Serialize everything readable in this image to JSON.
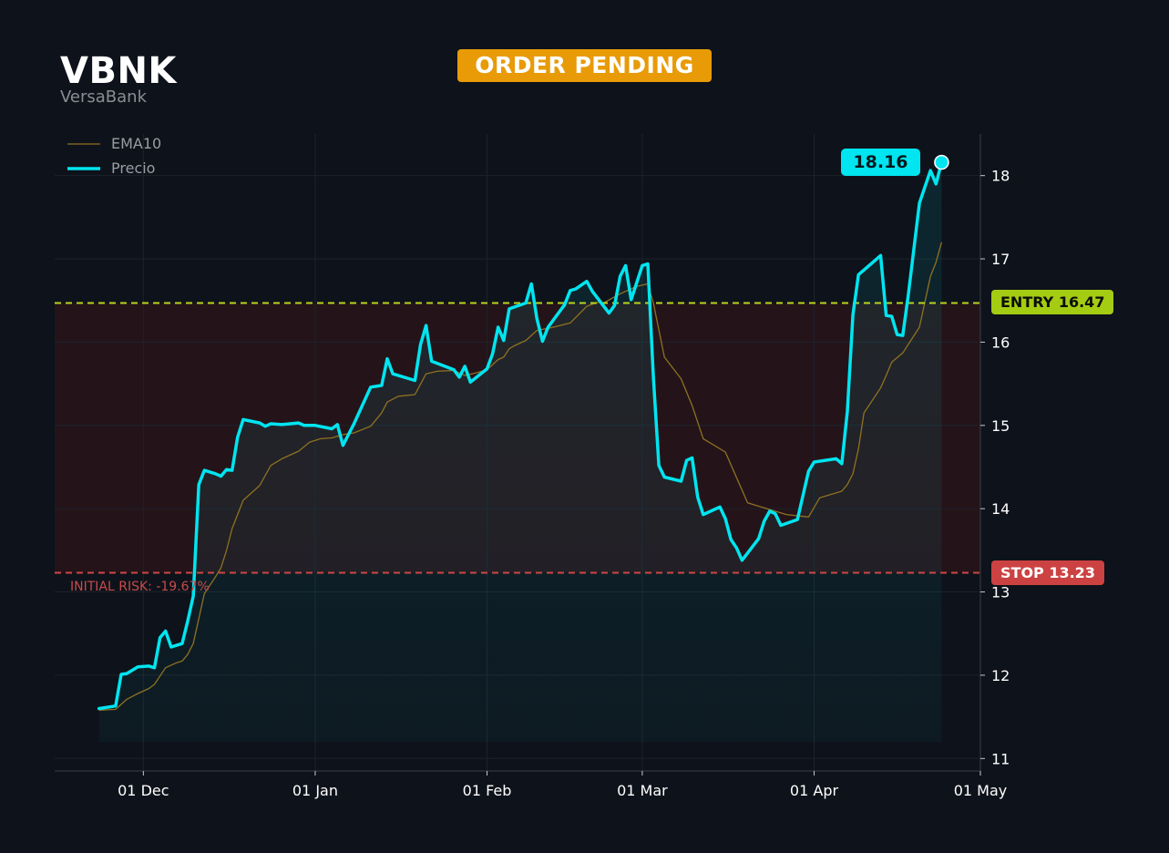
{
  "header": {
    "ticker": "VBNK",
    "company": "VersaBank",
    "status": "ORDER PENDING"
  },
  "colors": {
    "background": "#0e121a",
    "price_line": "#00e5f0",
    "ema_line": "#8f7121",
    "entry_line": "#b8d41c",
    "entry_tag": "#a4cc12",
    "stop_line": "#cf4646",
    "stop_tag": "#cc4242",
    "badge": "#e89b07",
    "risk_zone": "#2a1519"
  },
  "levels": {
    "entry": {
      "label": "ENTRY 16.47",
      "value": 16.47
    },
    "stop": {
      "label": "STOP 13.23",
      "value": 13.23
    },
    "risk_label": "INITIAL RISK: -19.67%"
  },
  "last_price": {
    "label": "18.16",
    "value": 18.16
  },
  "chart_data": {
    "type": "line",
    "legend": {
      "placement": "top-left",
      "entries": [
        "EMA10",
        "Precio"
      ]
    },
    "grid": true,
    "x_axis": {
      "type": "date",
      "range": [
        "2024-11-15",
        "2025-05-01"
      ],
      "tick_labels": [
        "01 Dec",
        "01 Jan",
        "01 Feb",
        "01 Mar",
        "01 Apr",
        "01 May"
      ],
      "tick_dates": [
        "2024-12-01",
        "2025-01-01",
        "2025-02-01",
        "2025-03-01",
        "2025-04-01",
        "2025-05-01"
      ]
    },
    "y_axis": {
      "range": [
        10.85,
        18.5
      ],
      "ticks": [
        11,
        12,
        13,
        14,
        15,
        16,
        17,
        18
      ]
    },
    "series": [
      {
        "name": "EMA10",
        "points": [
          [
            "2024-11-23",
            11.58
          ],
          [
            "2024-11-26",
            11.59
          ],
          [
            "2024-11-28",
            11.71
          ],
          [
            "2024-11-30",
            11.78
          ],
          [
            "2024-12-02",
            11.84
          ],
          [
            "2024-12-03",
            11.89
          ],
          [
            "2024-12-05",
            12.09
          ],
          [
            "2024-12-07",
            12.15
          ],
          [
            "2024-12-08",
            12.17
          ],
          [
            "2024-12-09",
            12.25
          ],
          [
            "2024-12-10",
            12.38
          ],
          [
            "2024-12-12",
            12.98
          ],
          [
            "2024-12-14",
            13.18
          ],
          [
            "2024-12-15",
            13.29
          ],
          [
            "2024-12-16",
            13.5
          ],
          [
            "2024-12-17",
            13.76
          ],
          [
            "2024-12-19",
            14.1
          ],
          [
            "2024-12-22",
            14.28
          ],
          [
            "2024-12-24",
            14.52
          ],
          [
            "2024-12-26",
            14.6
          ],
          [
            "2024-12-29",
            14.69
          ],
          [
            "2024-12-31",
            14.8
          ],
          [
            "2025-01-02",
            14.84
          ],
          [
            "2025-01-04",
            14.85
          ],
          [
            "2025-01-06",
            14.89
          ],
          [
            "2025-01-08",
            14.91
          ],
          [
            "2025-01-11",
            14.99
          ],
          [
            "2025-01-13",
            15.15
          ],
          [
            "2025-01-14",
            15.28
          ],
          [
            "2025-01-16",
            15.35
          ],
          [
            "2025-01-19",
            15.37
          ],
          [
            "2025-01-21",
            15.62
          ],
          [
            "2025-01-23",
            15.65
          ],
          [
            "2025-01-26",
            15.66
          ],
          [
            "2025-01-28",
            15.6
          ],
          [
            "2025-01-30",
            15.63
          ],
          [
            "2025-02-01",
            15.67
          ],
          [
            "2025-02-03",
            15.79
          ],
          [
            "2025-02-04",
            15.82
          ],
          [
            "2025-02-05",
            15.92
          ],
          [
            "2025-02-06",
            15.96
          ],
          [
            "2025-02-08",
            16.02
          ],
          [
            "2025-02-10",
            16.14
          ],
          [
            "2025-02-13",
            16.18
          ],
          [
            "2025-02-16",
            16.23
          ],
          [
            "2025-02-19",
            16.43
          ],
          [
            "2025-02-21",
            16.48
          ],
          [
            "2025-02-22",
            16.47
          ],
          [
            "2025-02-25",
            16.58
          ],
          [
            "2025-02-28",
            16.67
          ],
          [
            "2025-03-02",
            16.7
          ],
          [
            "2025-03-03",
            16.47
          ],
          [
            "2025-03-05",
            15.82
          ],
          [
            "2025-03-08",
            15.56
          ],
          [
            "2025-03-10",
            15.24
          ],
          [
            "2025-03-12",
            14.84
          ],
          [
            "2025-03-16",
            14.68
          ],
          [
            "2025-03-20",
            14.07
          ],
          [
            "2025-03-24",
            13.99
          ],
          [
            "2025-03-27",
            13.93
          ],
          [
            "2025-03-31",
            13.9
          ],
          [
            "2025-04-02",
            14.13
          ],
          [
            "2025-04-06",
            14.21
          ],
          [
            "2025-04-07",
            14.29
          ],
          [
            "2025-04-08",
            14.42
          ],
          [
            "2025-04-09",
            14.72
          ],
          [
            "2025-04-10",
            15.15
          ],
          [
            "2025-04-13",
            15.45
          ],
          [
            "2025-04-14",
            15.6
          ],
          [
            "2025-04-15",
            15.76
          ],
          [
            "2025-04-17",
            15.87
          ],
          [
            "2025-04-20",
            16.18
          ],
          [
            "2025-04-22",
            16.79
          ],
          [
            "2025-04-23",
            16.96
          ],
          [
            "2025-04-24",
            17.2
          ]
        ]
      },
      {
        "name": "Precio",
        "points": [
          [
            "2024-11-23",
            11.6
          ],
          [
            "2024-11-26",
            11.63
          ],
          [
            "2024-11-27",
            12.01
          ],
          [
            "2024-11-28",
            12.02
          ],
          [
            "2024-11-30",
            12.1
          ],
          [
            "2024-12-02",
            12.11
          ],
          [
            "2024-12-03",
            12.09
          ],
          [
            "2024-12-04",
            12.45
          ],
          [
            "2024-12-05",
            12.53
          ],
          [
            "2024-12-06",
            12.34
          ],
          [
            "2024-12-08",
            12.38
          ],
          [
            "2024-12-09",
            12.65
          ],
          [
            "2024-12-10",
            12.95
          ],
          [
            "2024-12-11",
            14.29
          ],
          [
            "2024-12-12",
            14.46
          ],
          [
            "2024-12-14",
            14.42
          ],
          [
            "2024-12-15",
            14.39
          ],
          [
            "2024-12-16",
            14.47
          ],
          [
            "2024-12-17",
            14.46
          ],
          [
            "2024-12-18",
            14.86
          ],
          [
            "2024-12-19",
            15.07
          ],
          [
            "2024-12-22",
            15.03
          ],
          [
            "2024-12-23",
            14.99
          ],
          [
            "2024-12-24",
            15.02
          ],
          [
            "2024-12-26",
            15.01
          ],
          [
            "2024-12-29",
            15.03
          ],
          [
            "2024-12-30",
            15.0
          ],
          [
            "2025-01-01",
            15.0
          ],
          [
            "2025-01-04",
            14.96
          ],
          [
            "2025-01-05",
            15.01
          ],
          [
            "2025-01-06",
            14.76
          ],
          [
            "2025-01-08",
            15.02
          ],
          [
            "2025-01-11",
            15.46
          ],
          [
            "2025-01-12",
            15.47
          ],
          [
            "2025-01-13",
            15.48
          ],
          [
            "2025-01-14",
            15.8
          ],
          [
            "2025-01-15",
            15.62
          ],
          [
            "2025-01-19",
            15.54
          ],
          [
            "2025-01-20",
            15.97
          ],
          [
            "2025-01-21",
            16.2
          ],
          [
            "2025-01-22",
            15.77
          ],
          [
            "2025-01-26",
            15.67
          ],
          [
            "2025-01-27",
            15.58
          ],
          [
            "2025-01-28",
            15.71
          ],
          [
            "2025-01-29",
            15.52
          ],
          [
            "2025-02-01",
            15.68
          ],
          [
            "2025-02-02",
            15.86
          ],
          [
            "2025-02-03",
            16.18
          ],
          [
            "2025-02-04",
            16.02
          ],
          [
            "2025-02-05",
            16.4
          ],
          [
            "2025-02-08",
            16.47
          ],
          [
            "2025-02-09",
            16.7
          ],
          [
            "2025-02-10",
            16.28
          ],
          [
            "2025-02-11",
            16.01
          ],
          [
            "2025-02-12",
            16.18
          ],
          [
            "2025-02-15",
            16.45
          ],
          [
            "2025-02-16",
            16.62
          ],
          [
            "2025-02-17",
            16.64
          ],
          [
            "2025-02-19",
            16.73
          ],
          [
            "2025-02-20",
            16.61
          ],
          [
            "2025-02-23",
            16.35
          ],
          [
            "2025-02-24",
            16.44
          ],
          [
            "2025-02-25",
            16.79
          ],
          [
            "2025-02-26",
            16.92
          ],
          [
            "2025-02-27",
            16.51
          ],
          [
            "2025-03-01",
            16.92
          ],
          [
            "2025-03-02",
            16.94
          ],
          [
            "2025-03-03",
            15.58
          ],
          [
            "2025-03-04",
            14.52
          ],
          [
            "2025-03-05",
            14.38
          ],
          [
            "2025-03-08",
            14.33
          ],
          [
            "2025-03-09",
            14.58
          ],
          [
            "2025-03-10",
            14.61
          ],
          [
            "2025-03-11",
            14.14
          ],
          [
            "2025-03-12",
            13.93
          ],
          [
            "2025-03-15",
            14.02
          ],
          [
            "2025-03-16",
            13.88
          ],
          [
            "2025-03-17",
            13.63
          ],
          [
            "2025-03-18",
            13.53
          ],
          [
            "2025-03-19",
            13.38
          ],
          [
            "2025-03-22",
            13.64
          ],
          [
            "2025-03-23",
            13.85
          ],
          [
            "2025-03-24",
            13.97
          ],
          [
            "2025-03-25",
            13.94
          ],
          [
            "2025-03-26",
            13.8
          ],
          [
            "2025-03-29",
            13.87
          ],
          [
            "2025-03-31",
            14.45
          ],
          [
            "2025-04-01",
            14.56
          ],
          [
            "2025-04-05",
            14.6
          ],
          [
            "2025-04-06",
            14.54
          ],
          [
            "2025-04-07",
            15.17
          ],
          [
            "2025-04-08",
            16.33
          ],
          [
            "2025-04-09",
            16.81
          ],
          [
            "2025-04-13",
            17.04
          ],
          [
            "2025-04-14",
            16.32
          ],
          [
            "2025-04-15",
            16.31
          ],
          [
            "2025-04-16",
            16.09
          ],
          [
            "2025-04-17",
            16.08
          ],
          [
            "2025-04-18",
            16.57
          ],
          [
            "2025-04-20",
            17.67
          ],
          [
            "2025-04-22",
            18.06
          ],
          [
            "2025-04-23",
            17.9
          ],
          [
            "2025-04-24",
            18.16
          ]
        ]
      }
    ]
  }
}
